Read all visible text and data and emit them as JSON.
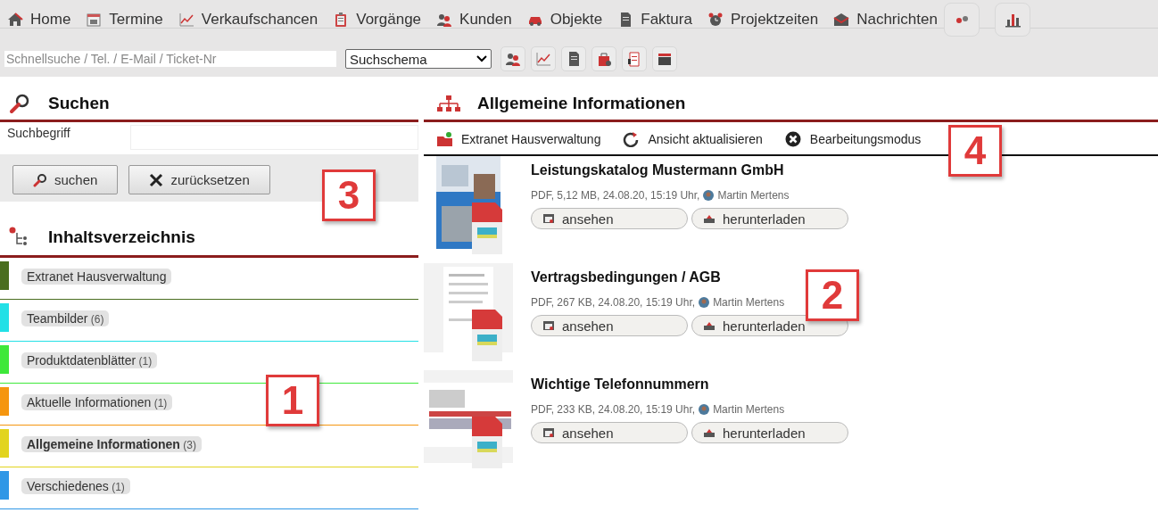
{
  "nav": [
    {
      "label": "Home"
    },
    {
      "label": "Termine"
    },
    {
      "label": "Verkaufschancen"
    },
    {
      "label": "Vorgänge"
    },
    {
      "label": "Kunden"
    },
    {
      "label": "Objekte"
    },
    {
      "label": "Faktura"
    },
    {
      "label": "Projektzeiten"
    },
    {
      "label": "Nachrichten"
    }
  ],
  "quick": {
    "search": {
      "placeholder": "Schnellsuche / Tel. / E-Mail / Ticket-Nr"
    },
    "schema": {
      "value": "Suchschema"
    }
  },
  "search_panel": {
    "title": "Suchen",
    "field_label": "Suchbegriff",
    "buttons": [
      "suchen",
      "zurücksetzen"
    ]
  },
  "toc": {
    "title": "Inhaltsverzeichnis",
    "items": [
      {
        "label": "Extranet Hausverwaltung",
        "color": "#4a6e1f",
        "selected": false
      },
      {
        "label": "Teambilder",
        "count": "(6)",
        "color": "#22e0e6",
        "selected": false
      },
      {
        "label": "Produktdatenblätter",
        "count": "(1)",
        "color": "#3ee83a",
        "selected": false
      },
      {
        "label": "Aktuelle Informationen",
        "count": "(1)",
        "color": "#f5960f",
        "selected": false
      },
      {
        "label": "Allgemeine Informationen",
        "count": "(3)",
        "color": "#e2d41e",
        "selected": true
      },
      {
        "label": "Verschiedenes",
        "count": "(1)",
        "color": "#2f97e6",
        "selected": false
      }
    ]
  },
  "content": {
    "title": "Allgemeine Informationen",
    "actions": [
      "Extranet Hausverwaltung",
      "Ansicht aktualisieren",
      "Bearbeitungsmodus"
    ],
    "documents": [
      {
        "title": "Leistungskatalog Mustermann GmbH",
        "meta": "PDF, 5,12 MB, 24.08.20, 15:19 Uhr,",
        "author": "Martin Mertens",
        "buttons": [
          "ansehen",
          "herunterladen"
        ]
      },
      {
        "title": "Vertragsbedingungen / AGB",
        "meta": "PDF, 267 KB, 24.08.20, 15:19 Uhr,",
        "author": "Martin Mertens",
        "buttons": [
          "ansehen",
          "herunterladen"
        ]
      },
      {
        "title": "Wichtige Telefonnummern",
        "meta": "PDF, 233 KB, 24.08.20, 15:19 Uhr,",
        "author": "Martin Mertens",
        "buttons": [
          "ansehen",
          "herunterladen"
        ]
      }
    ]
  },
  "callouts": [
    {
      "label": "1"
    },
    {
      "label": "2"
    },
    {
      "label": "3"
    },
    {
      "label": "4"
    }
  ]
}
